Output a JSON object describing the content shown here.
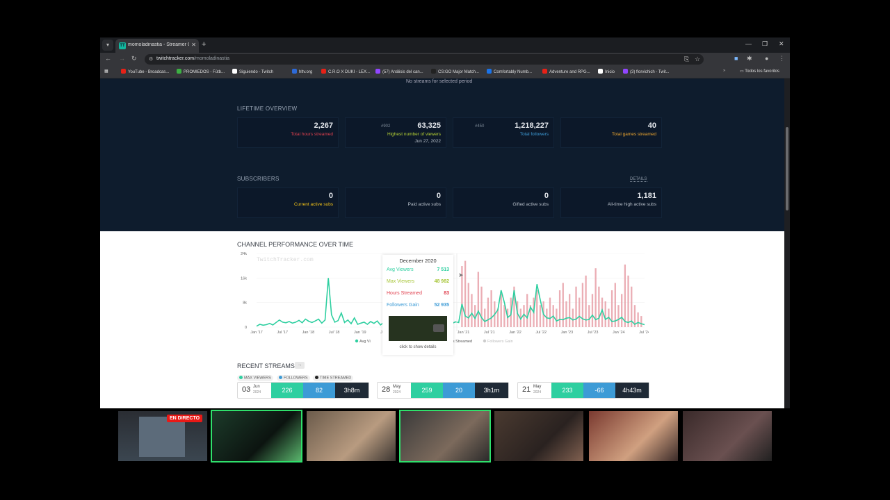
{
  "browser": {
    "tab_title": "momoladinastia - Streamer Ov...",
    "tab_favicon": "TT",
    "url_domain": "twitchtracker.com",
    "url_path": "/momoladinastia",
    "bookmarks": [
      {
        "label": "YouTube - Broadcas...",
        "color": "#e62117"
      },
      {
        "label": "PROMIEDOS - Fútb...",
        "color": "#3cb043"
      },
      {
        "label": "Siguiendo - Twitch",
        "color": "#ffffff"
      },
      {
        "label": "hltv.org",
        "color": "#2d6ad8"
      },
      {
        "label": "C.R.O X DUKI - LEX...",
        "color": "#e62117"
      },
      {
        "label": "(57) Análisis del can...",
        "color": "#9146ff"
      },
      {
        "label": "CS:GO Major Match...",
        "color": "#222222"
      },
      {
        "label": "Comfortably Numb...",
        "color": "#1a73e8"
      },
      {
        "label": "Adventure and RPG...",
        "color": "#e62117"
      },
      {
        "label": "Inicio",
        "color": "#ffffff"
      },
      {
        "label": "(3) florvichich - Twit...",
        "color": "#9146ff"
      }
    ],
    "all_bookmarks": "Todos los favoritos"
  },
  "page": {
    "no_streams": "No streams for selected period",
    "lifetime_title": "LIFETIME OVERVIEW",
    "lifetime": [
      {
        "rank": "",
        "value": "2,267",
        "label": "Total hours streamed",
        "sub": "",
        "color": "#e0414f"
      },
      {
        "rank": "#902",
        "value": "63,325",
        "label": "Highest number of viewers",
        "sub": "Jun 27, 2022",
        "color": "#b7d334"
      },
      {
        "rank": "#450",
        "value": "1,218,227",
        "label": "Total followers",
        "sub": "",
        "color": "#3d9bd6"
      },
      {
        "rank": "",
        "value": "40",
        "label": "Total games streamed",
        "sub": "",
        "color": "#f0a830"
      }
    ],
    "subscribers_title": "SUBSCRIBERS",
    "details_label": "DETAILS",
    "subscribers": [
      {
        "value": "0",
        "label": "Current active subs",
        "color": "#f5c518"
      },
      {
        "value": "0",
        "label": "Paid active subs",
        "color": "#b8c0ca"
      },
      {
        "value": "0",
        "label": "Gifted active subs",
        "color": "#b8c0ca"
      },
      {
        "value": "1,181",
        "label": "All-time high active subs",
        "color": "#b8c0ca"
      }
    ],
    "performance_title": "CHANNEL PERFORMANCE OVER TIME",
    "watermark": "TwitchTracker.com",
    "tooltip": {
      "title": "December 2020",
      "rows": [
        {
          "label": "Avg Viewers",
          "value": "7 513",
          "color": "#2ecfa0"
        },
        {
          "label": "Max Viewers",
          "value": "48 982",
          "color": "#a8c639"
        },
        {
          "label": "Hours Streamed",
          "value": "83",
          "color": "#e0414f"
        },
        {
          "label": "Followers Gain",
          "value": "52 935",
          "color": "#3d9bd6"
        }
      ],
      "click": "click to show details"
    },
    "chart_legend": [
      {
        "label": "Avg Vi",
        "color": "#2ecfa0"
      },
      {
        "label": "urs Streamed",
        "color": "#e0414f"
      },
      {
        "label": "Followers Gain",
        "color": "#cccccc"
      }
    ],
    "recent_title": "RECENT STREAMS",
    "recent_arrow": "→",
    "recent_legend": [
      {
        "label": "MAX VIEWERS",
        "color": "#2ecfa0"
      },
      {
        "label": "FOLLOWERS",
        "color": "#3d9bd6"
      },
      {
        "label": "TIME STREAMED",
        "color": "#222222"
      }
    ],
    "streams": [
      {
        "day": "03",
        "month": "Jun",
        "year": "2024",
        "max": "226",
        "followers": "82",
        "time": "3h8m"
      },
      {
        "day": "28",
        "month": "May",
        "year": "2024",
        "max": "259",
        "followers": "20",
        "time": "3h1m"
      },
      {
        "day": "21",
        "month": "May",
        "year": "2024",
        "max": "233",
        "followers": "-66",
        "time": "4h43m"
      }
    ]
  },
  "overlay": {
    "live_badge": "EN DIRECTO"
  },
  "chart_data": {
    "type": "line",
    "title": "CHANNEL PERFORMANCE OVER TIME",
    "x_ticks": [
      "Jan '17",
      "Jul '17",
      "Jan '18",
      "Jul '18",
      "Jan '19",
      "Jul '19",
      "Jan '20",
      "Jul '20",
      "Jan '21",
      "Jul '21",
      "Jan '22",
      "Jul '22",
      "Jan '23",
      "Jul '23",
      "Jan '24",
      "Jul '24"
    ],
    "y_ticks": [
      "0",
      "8k",
      "16k",
      "24k"
    ],
    "ylim": [
      0,
      24000
    ],
    "series": [
      {
        "name": "Avg Viewers",
        "color": "#2ecfa0",
        "values": [
          300,
          900,
          600,
          800,
          1200,
          700,
          1500,
          2300,
          1600,
          1400,
          1800,
          1300,
          1600,
          2200,
          1400,
          2600,
          1900,
          1500,
          2000,
          2600,
          1300,
          2300,
          16000,
          4000,
          1600,
          2100,
          4600,
          1500,
          2300,
          1100,
          3000,
          900,
          1300,
          1600,
          900,
          1800,
          1200,
          2000,
          700,
          1500,
          800,
          1300,
          600,
          900,
          1000,
          1200,
          800,
          1500,
          1100,
          900,
          1200,
          700,
          900,
          600,
          1000,
          800,
          700,
          1100,
          1300,
          1500,
          1200,
          1700,
          1500,
          7513,
          3600,
          3000,
          4500,
          2800,
          5200,
          3100,
          1800,
          2400,
          3000,
          4100,
          5600,
          12000,
          8000,
          3100,
          4000,
          12000,
          4500,
          2600,
          4200,
          3000,
          6500,
          4800,
          14000,
          9000,
          4200,
          3000,
          2800,
          3600,
          2000,
          2500,
          2400,
          2900,
          3100,
          2300,
          2600,
          3500,
          2700,
          2300,
          2500,
          3900,
          2400,
          2900,
          5600,
          2500,
          3200,
          1800,
          2000,
          2500,
          3200,
          1800,
          1500,
          2000,
          900,
          1500,
          1100,
          800
        ]
      },
      {
        "name": "Hours Streamed",
        "color": "#e8a0a8",
        "values": [
          0,
          0,
          0,
          0,
          0,
          0,
          0,
          0,
          0,
          0,
          0,
          0,
          0,
          0,
          0,
          0,
          0,
          0,
          0,
          0,
          0,
          0,
          0,
          0,
          0,
          0,
          0,
          0,
          0,
          0,
          0,
          0,
          0,
          0,
          0,
          0,
          0,
          0,
          0,
          0,
          0,
          0,
          0,
          0,
          0,
          0,
          0,
          0,
          0,
          0,
          0,
          0,
          0,
          0,
          0,
          0,
          0,
          0,
          0,
          0,
          0,
          0,
          0,
          83,
          90,
          60,
          45,
          30,
          75,
          55,
          25,
          40,
          50,
          35,
          25,
          45,
          30,
          25,
          40,
          55,
          35,
          25,
          30,
          45,
          30,
          40,
          50,
          30,
          35,
          25,
          40,
          30,
          25,
          50,
          60,
          35,
          45,
          25,
          55,
          40,
          60,
          70,
          30,
          45,
          80,
          55,
          40,
          35,
          25,
          50,
          60,
          30,
          45,
          85,
          70,
          55,
          30,
          20,
          15
        ]
      }
    ]
  }
}
